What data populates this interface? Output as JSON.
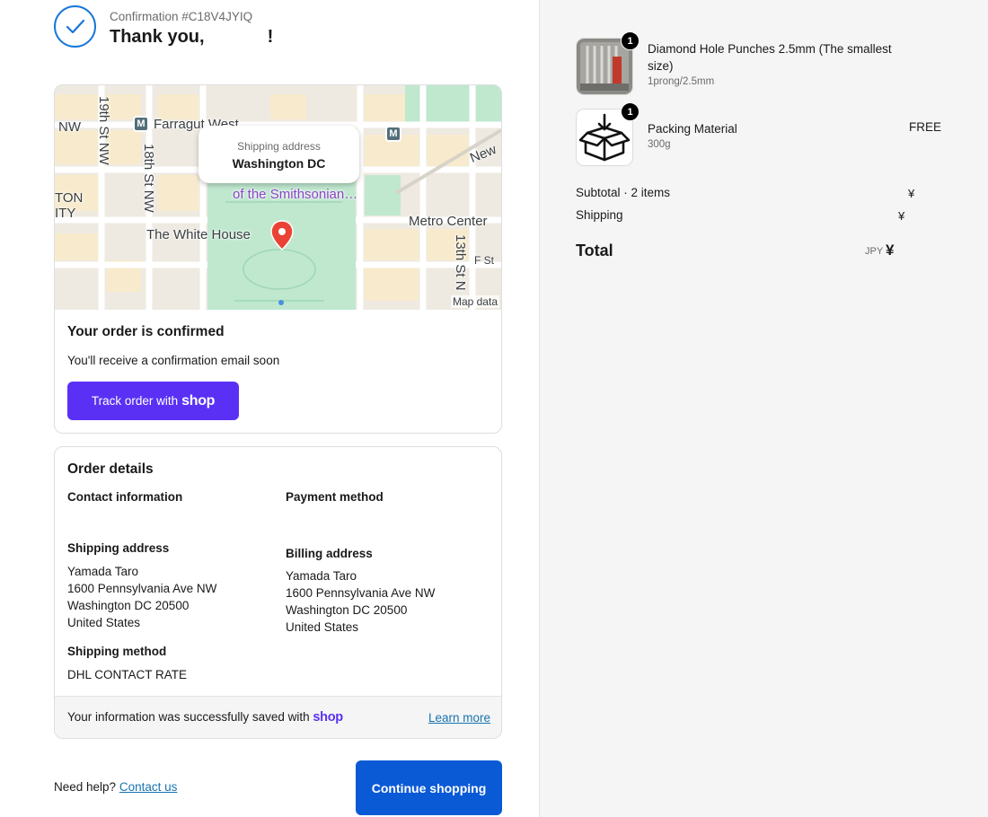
{
  "header": {
    "confirmation": "Confirmation #C18V4JYIQ",
    "thanks_prefix": "Thank you,",
    "thanks_suffix": "!"
  },
  "map": {
    "bubble_title": "Shipping address",
    "bubble_value": "Washington DC",
    "labels": {
      "farragut": "Farragut West",
      "nw_left": "NW",
      "st19": "19th St NW",
      "st18": "18th St NW",
      "st13": "13th St N",
      "ton": "TON",
      "ity": "ITY",
      "new": "New",
      "smithsonian": "of the Smithsonian…",
      "white_house": "The White House",
      "metro_center": "Metro Center",
      "f_st": "F St",
      "map_data": "Map data"
    },
    "colors": {
      "park": "#bfe8cf",
      "block": "#f8ebcd",
      "road": "#ffffff",
      "water": "#e8e4dc"
    }
  },
  "order_status": {
    "title": "Your order is confirmed",
    "message": "You'll receive a confirmation email soon",
    "track_label": "Track order with",
    "shop_brand": "shop"
  },
  "order_details": {
    "title": "Order details",
    "contact_heading": "Contact information",
    "payment_heading": "Payment method",
    "shipping_address_heading": "Shipping address",
    "shipping_address": [
      "Yamada Taro",
      "1600 Pennsylvania Ave NW",
      "Washington DC 20500",
      "United States"
    ],
    "billing_address_heading": "Billing address",
    "billing_address": [
      "Yamada Taro",
      "1600 Pennsylvania Ave NW",
      "Washington DC 20500",
      "United States"
    ],
    "shipping_method_heading": "Shipping method",
    "shipping_method": "DHL CONTACT RATE",
    "saved_text": "Your information was successfully saved with",
    "saved_brand": "shop",
    "learn_more": "Learn more"
  },
  "footer": {
    "need_help": "Need help?",
    "contact_us": "Contact us",
    "continue": "Continue shopping"
  },
  "summary": {
    "items": [
      {
        "name": "Diamond Hole Punches 2.5mm (The smallest size)",
        "variant": "1prong/2.5mm",
        "qty": "1",
        "price": "",
        "icon": "product-photo"
      },
      {
        "name": "Packing Material",
        "variant": "300g",
        "qty": "1",
        "price": "FREE",
        "icon": "box-download-icon"
      }
    ],
    "subtotal_label": "Subtotal · 2 items",
    "subtotal_value": "¥",
    "shipping_label": "Shipping",
    "shipping_value": "¥",
    "total_label": "Total",
    "currency": "JPY",
    "total_value": "¥"
  },
  "colors": {
    "accent": "#0a5ad6",
    "shop_purple": "#5a31f4",
    "link": "#1773b0",
    "check": "#1877d8"
  }
}
